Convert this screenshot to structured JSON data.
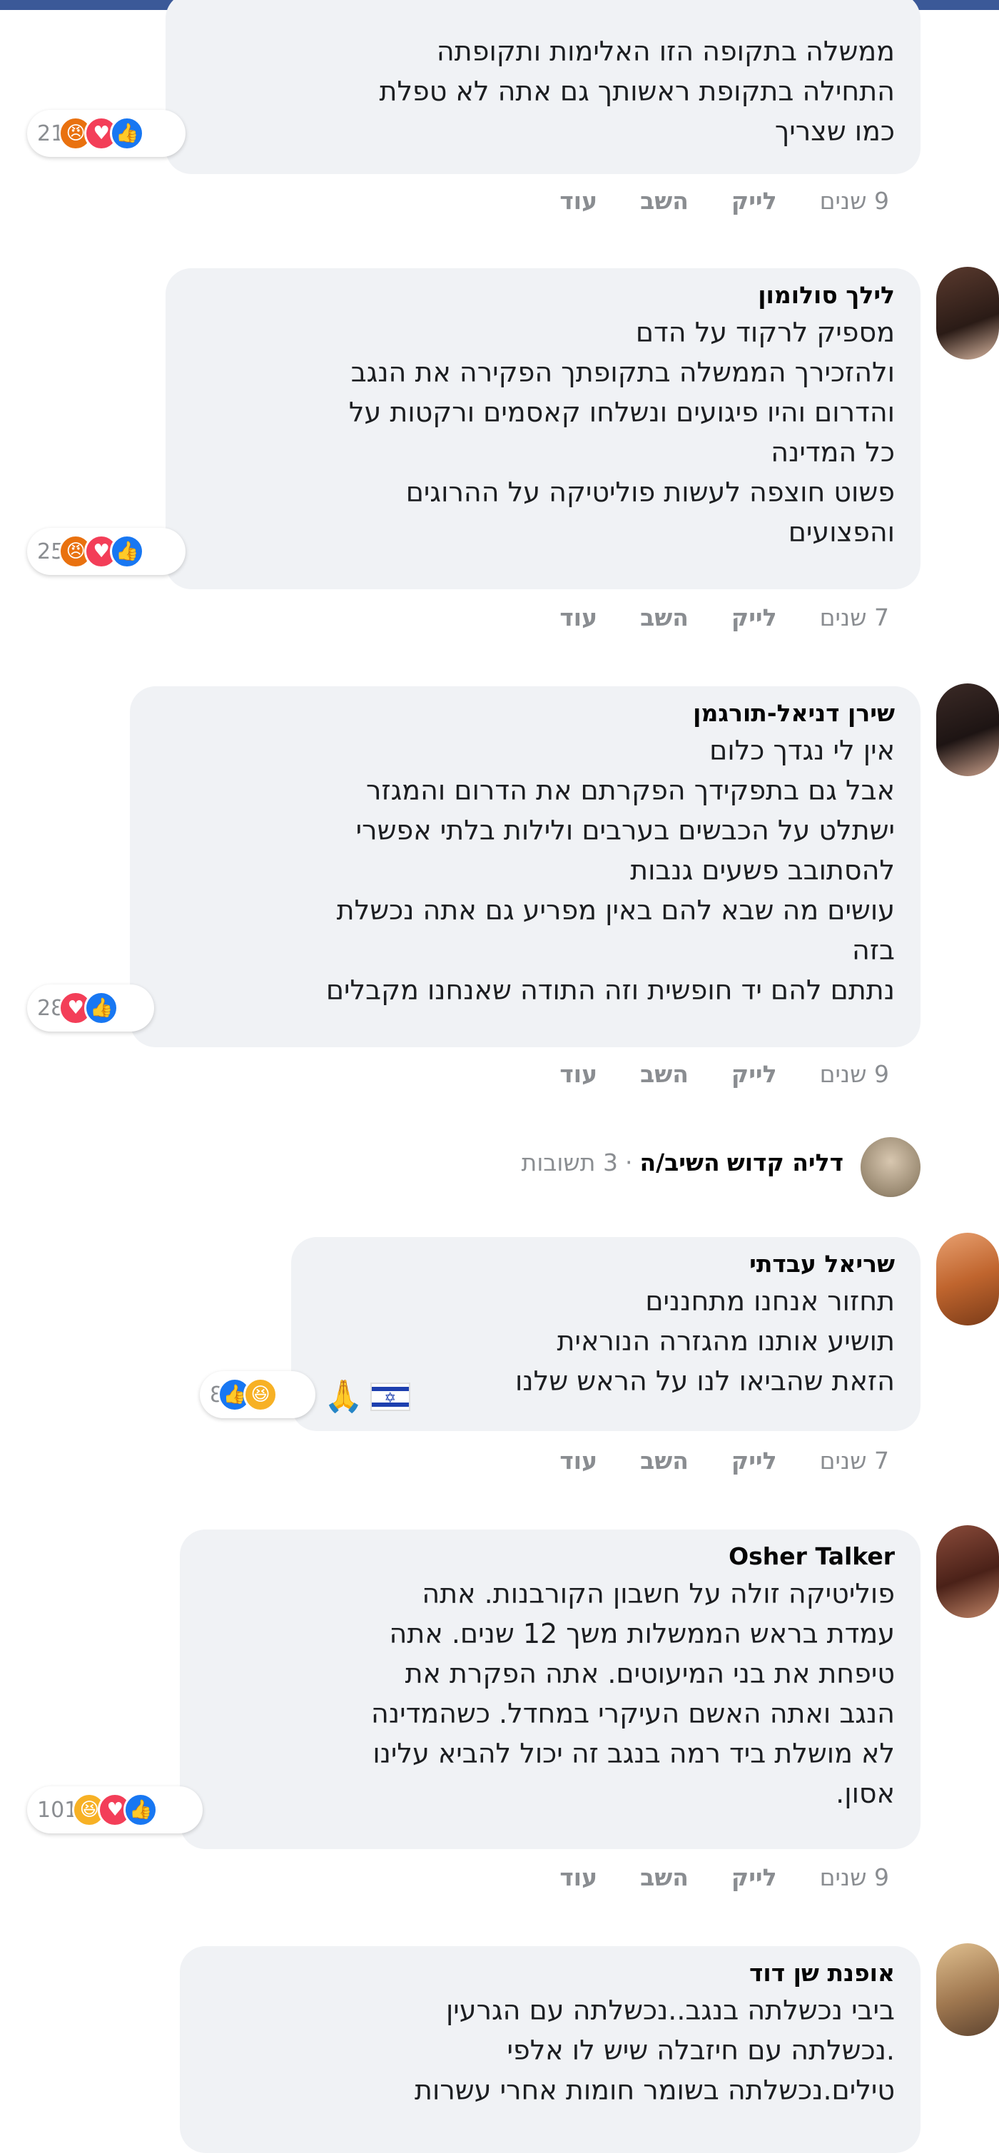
{
  "comments": [
    {
      "author": "",
      "lines": [
        "ממשלה בתקופה הזו האלימות ותקופתה",
        "התחילה בתקופת ראשותך גם אתה לא טפלת",
        "כמו שצריך"
      ],
      "reactions": {
        "count": "21",
        "icons": [
          "like-icon",
          "love-icon",
          "angry-icon"
        ]
      },
      "time": "9 שנים",
      "like": "לייק",
      "reply": "השב",
      "more": "עוד"
    },
    {
      "author": "לילך סולומון",
      "lines": [
        "מספיק לרקוד על הדם",
        "ולהזכירך הממשלה בתקופתך הפקירה את הנגב",
        "והדרום והיו פיגועים ונשלחו קאסמים ורקטות על",
        "כל המדינה",
        "פשוט חוצפה לעשות פוליטיקה על ההרוגים",
        "והפצועים"
      ],
      "reactions": {
        "count": "25",
        "icons": [
          "like-icon",
          "love-icon",
          "angry-icon"
        ]
      },
      "time": "7 שנים",
      "like": "לייק",
      "reply": "השב",
      "more": "עוד"
    },
    {
      "author": "שירן דניאל-תורגמן",
      "lines": [
        "אין לי נגדך כלום",
        "אבל גם בתפקידך הפקרתם את הדרום והמגזר",
        "ישתלט על הכבשים בערבים ולילות בלתי אפשרי",
        "להסתובב פשעים גנבות",
        "עושים מה שבא להם באין מפריע גם אתה נכשלת",
        "בזה",
        "נתתם להם יד חופשית וזה התודה שאנחנו מקבלים"
      ],
      "reactions": {
        "count": "28",
        "icons": [
          "like-icon",
          "love-icon"
        ]
      },
      "time": "9 שנים",
      "like": "לייק",
      "reply": "השב",
      "more": "עוד"
    },
    {
      "author": "שריאל עבדתי",
      "lines": [
        "תחזור אנחנו מתחננים",
        "תושיע אותנו מהגזרה הנוראית",
        "הזאת שהביאו לנו על הראש שלנו"
      ],
      "reactions": {
        "count": "8",
        "icons": [
          "like-icon",
          "haha-icon"
        ]
      },
      "time": "7 שנים",
      "like": "לייק",
      "reply": "השב",
      "more": "עוד"
    },
    {
      "author": "Osher Talker",
      "lines": [
        "פוליטיקה זולה על חשבון הקורבנות. אתה",
        "עמדת בראש הממשלות משך 12 שנים. אתה",
        "טיפחת את בני המיעוטים. אתה הפקרת את",
        "הנגב ואתה האשם העיקרי במחדל. כשהמדינה",
        "לא מושלת ביד רמה בנגב זה יכול להביא עלינו",
        "אסון."
      ],
      "reactions": {
        "count": "101",
        "icons": [
          "like-icon",
          "love-icon",
          "haha-icon"
        ]
      },
      "time": "9 שנים",
      "like": "לייק",
      "reply": "השב",
      "more": "עוד"
    },
    {
      "author": "אופנת שן דוד",
      "lines": [
        "ביבי נכשלתה בנגב..נכשלתה עם הגרעין",
        ".נכשלתה עם חיזבלה שיש לו אלפי",
        "טילים.נכשלתה בשומר חומות אחרי עשרות"
      ]
    }
  ],
  "thread": {
    "name": "דליה קדוש",
    "verb": "השיב/ה",
    "separator": "·",
    "replies": "3 תשובות"
  },
  "colors": {
    "bubble": "#f0f2f5",
    "like": "#1877f2",
    "love": "#f33e58",
    "angry": "#e9710f",
    "haha": "#f7b125",
    "muted": "#8a8d91"
  }
}
